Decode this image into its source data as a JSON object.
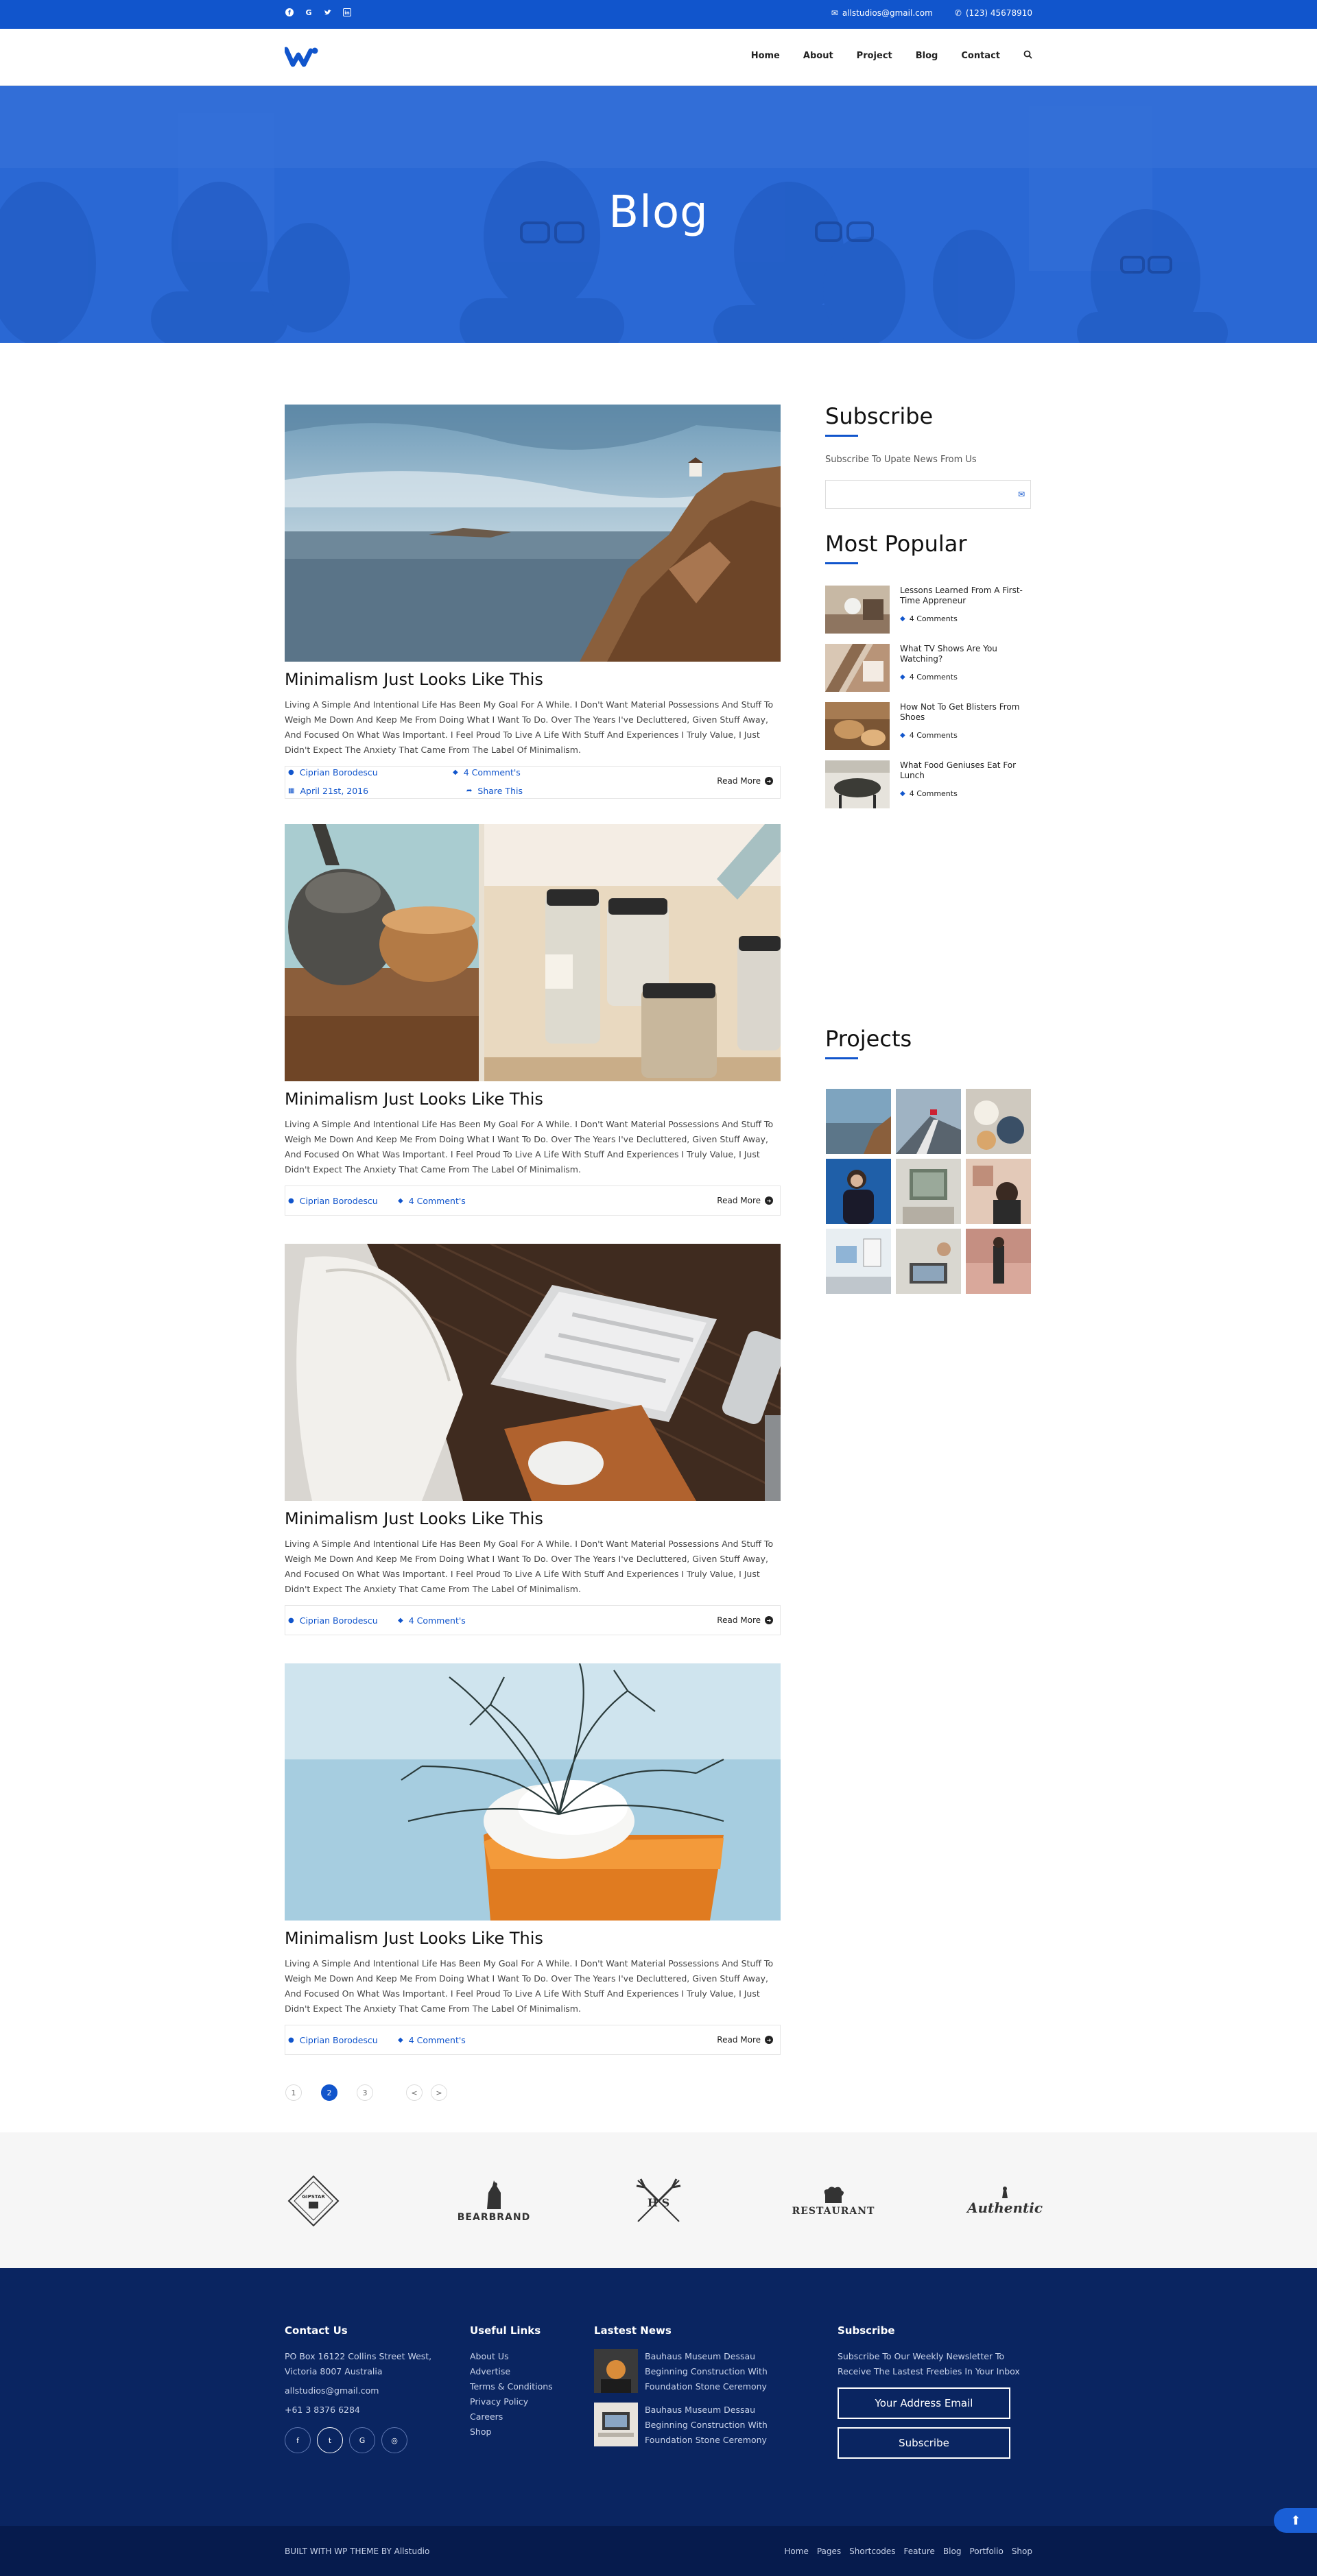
{
  "topbar": {
    "email": "allstudios@gmail.com",
    "phone": "(123) 45678910",
    "socials": [
      "facebook-icon",
      "google-icon",
      "twitter-icon",
      "linkedin-icon"
    ]
  },
  "nav": {
    "items": [
      "Home",
      "About",
      "Project",
      "Blog",
      "Contact"
    ]
  },
  "hero": {
    "title": "Blog"
  },
  "posts": [
    {
      "title": "Minimalism Just Looks Like This",
      "excerpt": "Living A Simple And Intentional Life Has Been My Goal For A While. I Don't Want Material Possessions And Stuff To Weigh Me Down And Keep Me From Doing What I Want To Do. Over The Years I've Decluttered, Given Stuff Away, And Focused On What Was Important. I Feel Proud To Live A Life With Stuff And Experiences I Truly Value, I Just Didn't Expect The Anxiety That Came From The Label Of Minimalism.",
      "author": "Ciprian Borodescu",
      "comments": "4 Comment's",
      "date": "April 21st, 2016",
      "share": "Share This",
      "read_more": "Read More"
    },
    {
      "title": "Minimalism Just Looks Like This",
      "excerpt": "Living A Simple And Intentional Life Has Been My Goal For A While. I Don't Want Material Possessions And Stuff To Weigh Me Down And Keep Me From Doing What I Want To Do. Over The Years I've Decluttered, Given Stuff Away, And Focused On What Was Important. I Feel Proud To Live A Life With Stuff And Experiences I Truly Value, I Just Didn't Expect The Anxiety That Came From The Label Of Minimalism.",
      "author": "Ciprian Borodescu",
      "comments": "4 Comment's",
      "read_more": "Read More"
    },
    {
      "title": "Minimalism Just Looks Like This",
      "excerpt": "Living A Simple And Intentional Life Has Been My Goal For A While. I Don't Want Material Possessions And Stuff To Weigh Me Down And Keep Me From Doing What I Want To Do. Over The Years I've Decluttered, Given Stuff Away, And Focused On What Was Important. I Feel Proud To Live A Life With Stuff And Experiences I Truly Value, I Just Didn't Expect The Anxiety That Came From The Label Of Minimalism.",
      "author": "Ciprian Borodescu",
      "comments": "4 Comment's",
      "read_more": "Read More"
    },
    {
      "title": "Minimalism Just Looks Like This",
      "excerpt": "Living A Simple And Intentional Life Has Been My Goal For A While. I Don't Want Material Possessions And Stuff To Weigh Me Down And Keep Me From Doing What I Want To Do. Over The Years I've Decluttered, Given Stuff Away, And Focused On What Was Important. I Feel Proud To Live A Life With Stuff And Experiences I Truly Value, I Just Didn't Expect The Anxiety That Came From The Label Of Minimalism.",
      "author": "Ciprian Borodescu",
      "comments": "4 Comment's",
      "read_more": "Read More"
    }
  ],
  "pagination": {
    "pages": [
      "1",
      "2",
      "3"
    ],
    "active": "2",
    "prev": "<",
    "next": ">"
  },
  "sidebar": {
    "subscribe_title": "Subscribe",
    "subscribe_text": "Subscribe To Upate News From Us",
    "popular_title": "Most Popular",
    "popular": [
      {
        "title": "Lessons Learned From A First-Time Appreneur",
        "comments": "4 Comments"
      },
      {
        "title": "What TV Shows Are You Watching?",
        "comments": "4 Comments"
      },
      {
        "title": "How Not To Get Blisters From Shoes",
        "comments": "4 Comments"
      },
      {
        "title": "What Food Geniuses Eat For Lunch",
        "comments": "4 Comments"
      }
    ],
    "projects_title": "Projects"
  },
  "brands": [
    "GIPSTAR",
    "BEARBRAND",
    "H S",
    "RESTAURANT",
    "Authentic"
  ],
  "footer": {
    "contact": {
      "title": "Contact Us",
      "address1": "PO Box 16122 Collins Street West,",
      "address2": "Victoria 8007 Australia",
      "email": "allstudios@gmail.com",
      "phone": "+61 3 8376 6284"
    },
    "links": {
      "title": "Useful Links",
      "items": [
        "About Us",
        "Advertise",
        "Terms & Conditions",
        "Privacy Policy",
        "Careers",
        "Shop"
      ]
    },
    "news": {
      "title": "Lastest News",
      "items": [
        "Bauhaus Museum Dessau Beginning Construction With Foundation Stone Ceremony",
        "Bauhaus Museum Dessau Beginning Construction With Foundation Stone Ceremony"
      ]
    },
    "subscribe": {
      "title": "Subscribe",
      "text": "Subscribe To Our Weekly Newsletter To Receive The Lastest Freebies In Your Inbox",
      "email_placeholder": "Your Address Email",
      "button": "Subscribe"
    }
  },
  "bottom": {
    "credit": "BUILT WITH WP THEME BY Allstudio",
    "links": [
      "Home",
      "Pages",
      "Shortcodes",
      "Feature",
      "Blog",
      "Portfolio",
      "Shop"
    ]
  },
  "colors": {
    "primary": "#1155cc",
    "footer_bg": "#0a2561",
    "bottom_bg": "#061b4d"
  }
}
